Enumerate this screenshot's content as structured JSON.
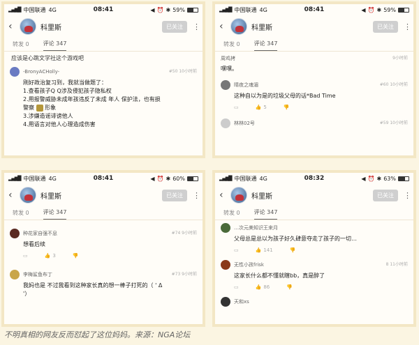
{
  "panels": [
    {
      "status": {
        "carrier": "中国联通",
        "network": "4G",
        "time": "08:41",
        "battery": "59%",
        "battery_level": 0.59
      },
      "header": {
        "username": "科里斯",
        "follow": "已关注"
      },
      "tabs": {
        "repost": "转发 0",
        "comments": "评论 347"
      },
      "top_line": "应该是心跳文学社这个游戏吧",
      "comments": [
        {
          "author": "-BronyACHolly-",
          "meta": "#50 10小时前",
          "lines": [
            "刚好政治复习到，我就当做题了：",
            "1.查看孩子Q Q涉及侵犯孩子隐私权",
            "2.用报警威胁未成年孩违反了未成 年人 保护法，也有损",
            "警察",
            "形象",
            "3.涉嫌造谣诽谤他人",
            "4.用语言对他人心理造成伤害"
          ]
        }
      ]
    },
    {
      "status": {
        "carrier": "中国联通",
        "network": "4G",
        "time": "08:41",
        "battery": "59%",
        "battery_level": 0.59
      },
      "header": {
        "username": "科里斯",
        "follow": "已关注"
      },
      "tabs": {
        "repost": "转发 0",
        "comments": "评论 347"
      },
      "comments": [
        {
          "author": "周鸡拷",
          "meta": "9小时前",
          "lines": [
            "嘿嘿。"
          ]
        },
        {
          "author": "晴夜之魂湄",
          "meta": "#60 10小时前",
          "lines": [
            "这种自以为是的垃圾父母的话*Bad Time"
          ],
          "likes": "5"
        },
        {
          "author": "林林02号",
          "meta": "#59 10小时前",
          "lines": []
        }
      ]
    },
    {
      "status": {
        "carrier": "中国联通",
        "network": "4G",
        "time": "08:41",
        "battery": "60%",
        "battery_level": 0.6
      },
      "header": {
        "username": "科里斯",
        "follow": "已关注"
      },
      "tabs": {
        "repost": "转发 0",
        "comments": "评论 347"
      },
      "comments": [
        {
          "author": "种花家自强不息",
          "meta": "#74 9小时前",
          "lines": [
            "想看后续"
          ],
          "likes": "3"
        },
        {
          "author": "李梅鲨鱼布丁",
          "meta": "#73 9小时前",
          "lines": [
            "我妈也是 不过我看到这种家长真的想一棒子打死的（ ' Δ",
            "'）"
          ]
        }
      ]
    },
    {
      "status": {
        "carrier": "中国联通",
        "network": "4G",
        "time": "08:32",
        "battery": "63%",
        "battery_level": 0.63
      },
      "header": {
        "username": "科里斯",
        "follow": "已关注"
      },
      "tabs": {
        "repost": "转发 0",
        "comments": "评论 347"
      },
      "comments": [
        {
          "author": "…次元美知识王来月",
          "meta": "",
          "lines": [
            "父母总是总以为孩子好久肆意夺走了孩子的一切…"
          ],
          "likes": "141"
        },
        {
          "author": "无性小孩frisk",
          "meta": "8 11小时前",
          "lines": [
            "这家长什么都不懂就瞎bb，真是醉了"
          ],
          "likes": "86"
        },
        {
          "author": "天和xs",
          "meta": "",
          "lines": []
        }
      ]
    }
  ],
  "caption": "不明真相的网友反而怼起了这位妈妈。来源：NGA论坛"
}
